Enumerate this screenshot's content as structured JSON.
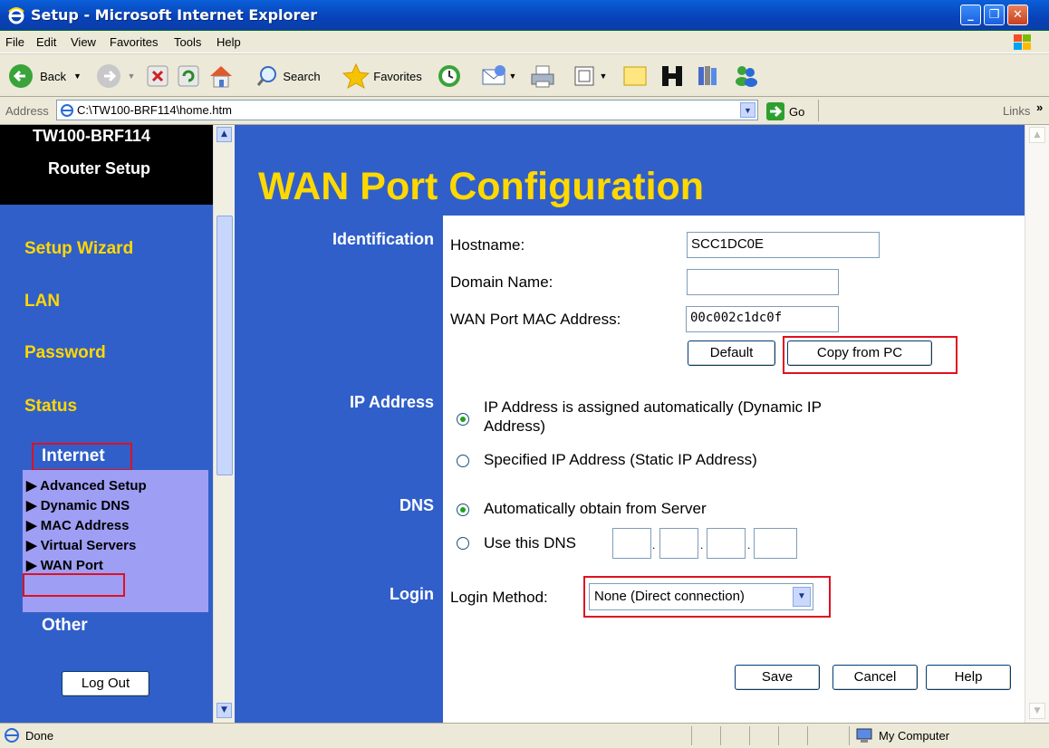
{
  "window": {
    "title": "Setup - Microsoft Internet Explorer"
  },
  "menu": [
    "File",
    "Edit",
    "View",
    "Favorites",
    "Tools",
    "Help"
  ],
  "toolbar": {
    "back": "Back",
    "search": "Search",
    "favorites": "Favorites"
  },
  "address": {
    "label": "Address",
    "url": "C:\\TW100-BRF114\\home.htm",
    "go": "Go",
    "links": "Links"
  },
  "sidebar": {
    "header_line1": "TW100-BRF114",
    "header_line2": "Router Setup",
    "items": [
      "Setup Wizard",
      "LAN",
      "Password",
      "Status"
    ],
    "internet": "Internet",
    "sub_items": [
      "Advanced Setup",
      "Dynamic DNS",
      "MAC Address",
      "Virtual Servers",
      "WAN Port"
    ],
    "other": "Other",
    "logout": "Log Out"
  },
  "main": {
    "title": "WAN Port Configuration",
    "sections": {
      "identification": "Identification",
      "ip_address": "IP Address",
      "dns": "DNS",
      "login": "Login"
    },
    "hostname_label": "Hostname:",
    "hostname_value": "SCC1DC0E",
    "domain_label": "Domain Name:",
    "domain_value": "",
    "mac_label": "WAN Port MAC Address:",
    "mac_value": "00c002c1dc0f",
    "default_button": "Default",
    "copy_button": "Copy from PC",
    "ip_dynamic_line1": "IP Address is assigned automatically (Dynamic IP",
    "ip_dynamic_line2": "Address)",
    "ip_static": "Specified IP Address (Static IP Address)",
    "dns_auto": "Automatically obtain from Server",
    "dns_manual": "Use this DNS",
    "dns_sep": ".",
    "login_label": "Login Method:",
    "login_value": "None (Direct connection)",
    "save": "Save",
    "cancel": "Cancel",
    "help": "Help"
  },
  "status": {
    "left": "Done",
    "zone": "My Computer"
  }
}
